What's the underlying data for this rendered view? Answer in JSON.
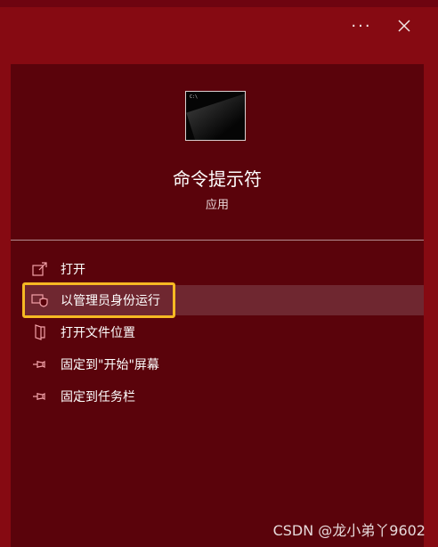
{
  "titlebar": {
    "more_icon": "ellipsis-icon",
    "close_icon": "close-icon"
  },
  "app": {
    "icon": "command-prompt-icon",
    "icon_caption": "C:\\",
    "name": "命令提示符",
    "type": "应用"
  },
  "menu": {
    "items": [
      {
        "label": "打开",
        "icon": "open-icon"
      },
      {
        "label": "以管理员身份运行",
        "icon": "shield-icon",
        "highlighted": true
      },
      {
        "label": "打开文件位置",
        "icon": "folder-icon"
      },
      {
        "label": "固定到\"开始\"屏幕",
        "icon": "pin-icon"
      },
      {
        "label": "固定到任务栏",
        "icon": "pin-icon"
      }
    ]
  },
  "watermark": "CSDN @龙小弟丫9602",
  "colors": {
    "background": "#860a12",
    "panel": "#5a030b",
    "highlight_row": "#6f2730",
    "highlight_border": "#f6b923",
    "icon_stroke": "#f2a1a8"
  }
}
